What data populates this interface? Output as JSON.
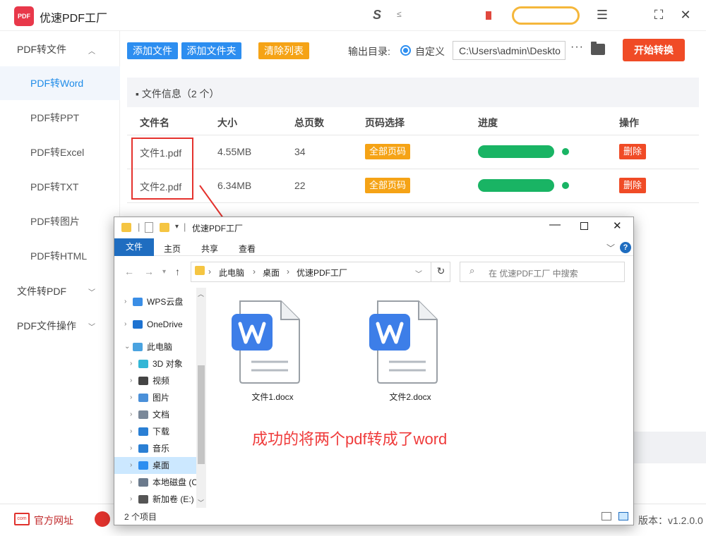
{
  "app": {
    "title": "优速PDF工厂",
    "logo_text": "PDF"
  },
  "titlebar": {
    "mid_logo": "S",
    "mid_logo_small": "≤"
  },
  "sidebar": {
    "groups": [
      {
        "label": "PDF转文件",
        "expanded": true
      },
      {
        "label": "文件转PDF",
        "expanded": false
      },
      {
        "label": "PDF文件操作",
        "expanded": false
      }
    ],
    "items": [
      "PDF转Word",
      "PDF转PPT",
      "PDF转Excel",
      "PDF转TXT",
      "PDF转图片",
      "PDF转HTML"
    ],
    "active_item": "PDF转Word"
  },
  "toolbar": {
    "add_file": "添加文件",
    "add_folder": "添加文件夹",
    "clear_list": "清除列表",
    "output_label": "输出目录:",
    "output_mode": "自定义",
    "output_path": "C:\\Users\\admin\\Deskto",
    "more": "···",
    "start": "开始转换"
  },
  "table": {
    "header_title": "文件信息（2 个）",
    "columns": [
      "文件名",
      "大小",
      "总页数",
      "页码选择",
      "进度",
      "操作"
    ],
    "rows": [
      {
        "name": "文件1.pdf",
        "size": "4.55MB",
        "pages": "34",
        "page_sel": "全部页码",
        "progress": 1.0,
        "action": "删除"
      },
      {
        "name": "文件2.pdf",
        "size": "6.34MB",
        "pages": "22",
        "page_sel": "全部页码",
        "progress": 1.0,
        "action": "删除"
      }
    ]
  },
  "footer": {
    "site": "官方网址",
    "version": "版本：v1.2.0.0"
  },
  "explorer": {
    "title": "优速PDF工厂",
    "tabs": [
      "文件",
      "主页",
      "共享",
      "查看"
    ],
    "breadcrumb": [
      "此电脑",
      "桌面",
      "优速PDF工厂"
    ],
    "search_placeholder": "在 优速PDF工厂 中搜索",
    "tree": [
      {
        "label": "WPS云盘",
        "icon": "cloud-icon",
        "color": "#3a8ee6"
      },
      {
        "label": "OneDrive",
        "icon": "onedrive-icon",
        "color": "#1e73d1"
      },
      {
        "label": "此电脑",
        "icon": "computer-icon",
        "color": "#4aa3e0"
      },
      {
        "label": "3D 对象",
        "icon": "cube-icon",
        "color": "#32b6d6"
      },
      {
        "label": "视频",
        "icon": "video-icon",
        "color": "#444444"
      },
      {
        "label": "图片",
        "icon": "picture-icon",
        "color": "#4a90d9"
      },
      {
        "label": "文档",
        "icon": "document-icon",
        "color": "#7a8899"
      },
      {
        "label": "下载",
        "icon": "download-icon",
        "color": "#2a7fd4"
      },
      {
        "label": "音乐",
        "icon": "music-icon",
        "color": "#2a7fd4"
      },
      {
        "label": "桌面",
        "icon": "desktop-icon",
        "color": "#2d8ef0"
      },
      {
        "label": "本地磁盘 (C",
        "icon": "disk-icon",
        "color": "#6b7a8c"
      },
      {
        "label": "新加卷 (E:)",
        "icon": "drive-icon",
        "color": "#555555"
      }
    ],
    "selected_tree": "桌面",
    "files": [
      {
        "name": "文件1.docx",
        "icon": "word-doc-icon"
      },
      {
        "name": "文件2.docx",
        "icon": "word-doc-icon"
      }
    ],
    "status": "2 个项目"
  },
  "annotation": "成功的将两个pdf转成了word",
  "colors": {
    "accent": "#2d8ef0",
    "orange": "#f5a316",
    "red": "#f04b26",
    "green": "#19b464",
    "word_blue": "#3d7ee8"
  }
}
